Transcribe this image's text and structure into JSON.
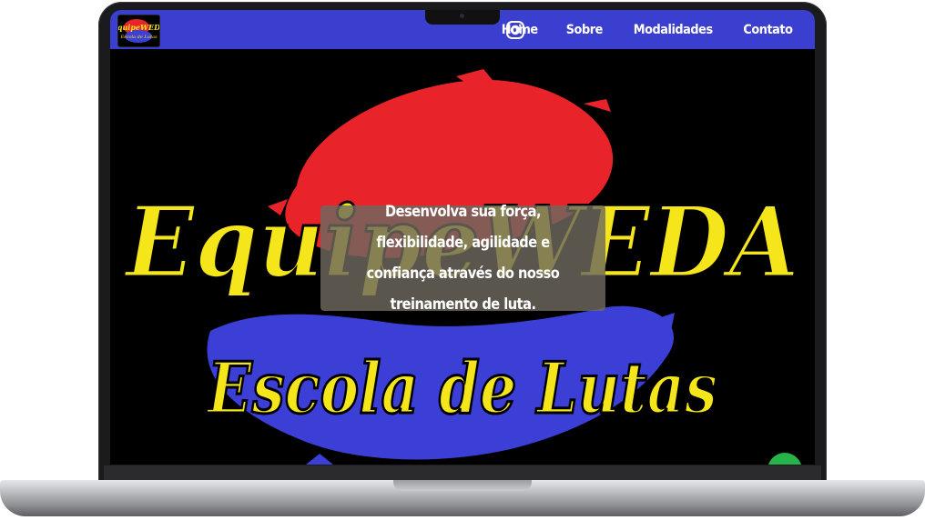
{
  "header": {
    "logo": {
      "text": "EquipeWEDA",
      "subtext": "Escola de Lutas"
    },
    "instagram_icon": "instagram-icon",
    "nav": [
      {
        "label": "Home"
      },
      {
        "label": "Sobre"
      },
      {
        "label": "Modalidades"
      },
      {
        "label": "Contato"
      }
    ],
    "bar_color": "#3a3fd0"
  },
  "hero": {
    "background_text_line1": "EquipeWEDA",
    "background_text_line2": "Escola de Lutas",
    "tagline": "Desenvolva sua força, flexibilidade, agilidade e confiança através do nosso treinamento de luta.",
    "colors": {
      "red": "#e8232a",
      "blue": "#3b3fd6",
      "yellow": "#f5e51b"
    }
  },
  "whatsapp": {
    "icon": "whatsapp-icon",
    "color": "#25b34a"
  }
}
